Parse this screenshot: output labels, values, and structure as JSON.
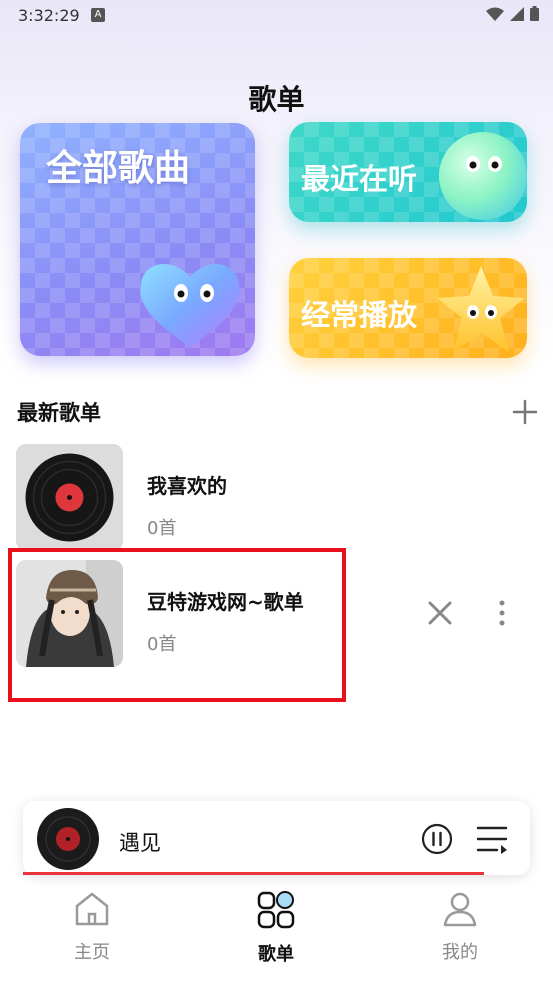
{
  "status_bar": {
    "time": "3:32:29",
    "notif_letter": "A"
  },
  "header": {
    "title": "歌单"
  },
  "cards": {
    "all_songs": "全部歌曲",
    "recent": "最近在听",
    "frequent": "经常播放"
  },
  "section": {
    "title": "最新歌单",
    "add_icon": "plus-icon"
  },
  "playlists": [
    {
      "name": "我喜欢的",
      "count": "0首",
      "cover": "vinyl-record"
    },
    {
      "name": "豆特游戏网~歌单",
      "count": "0首",
      "cover": "photo-girl"
    }
  ],
  "player": {
    "title": "遇见",
    "progress": 0.91
  },
  "tabs": [
    {
      "label": "主页",
      "icon": "home-icon"
    },
    {
      "label": "歌单",
      "icon": "playlist-grid-icon"
    },
    {
      "label": "我的",
      "icon": "user-icon"
    }
  ],
  "colors": {
    "accent_red": "#e8101a",
    "progress": "#e8343a"
  }
}
